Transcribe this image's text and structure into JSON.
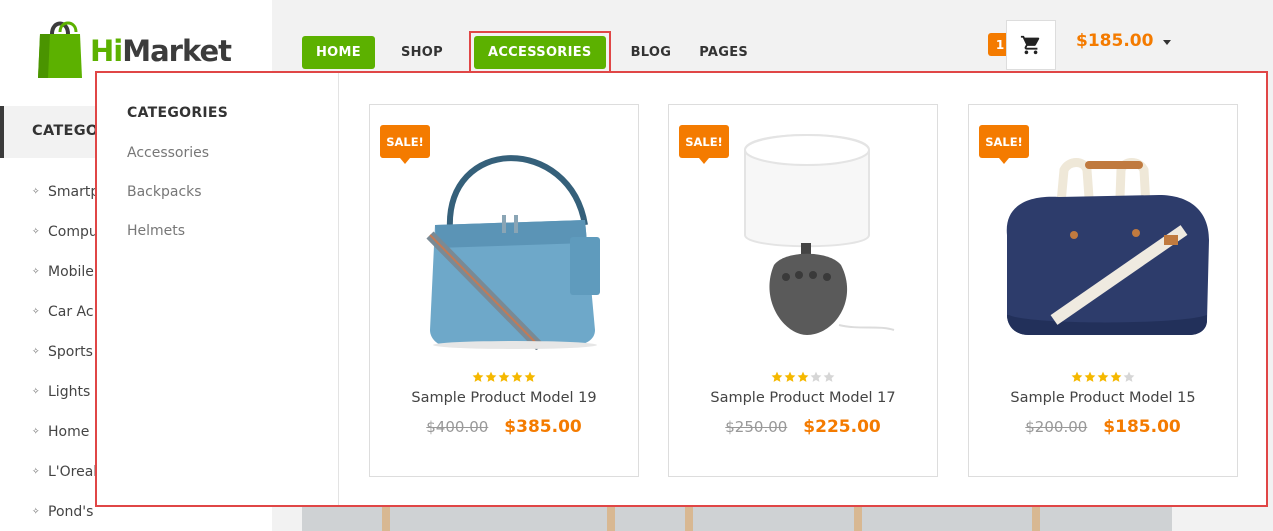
{
  "brand": {
    "name_hi": "Hi",
    "name_market": "Market",
    "colors": {
      "green": "#5cb100",
      "orange": "#f47b00"
    }
  },
  "sidebar": {
    "header": "CATEGO",
    "items": [
      "Smartp",
      "Compu",
      "Mobile",
      "Car Ac",
      "Sports",
      "Lights &",
      "Home ",
      "L'Oreal",
      "Pond's"
    ]
  },
  "nav": {
    "items": [
      "HOME",
      "SHOP",
      "ACCESSORIES",
      "BLOG",
      "PAGES"
    ],
    "active": "ACCESSORIES"
  },
  "cart": {
    "count": "1",
    "total": "$185.00",
    "icon": "cart-icon"
  },
  "mega_menu": {
    "title": "CATEGORIES",
    "links": [
      "Accessories",
      "Backpacks",
      "Helmets"
    ],
    "products": [
      {
        "badge": "SALE!",
        "name": "Sample Product Model 19",
        "old_price": "$400.00",
        "new_price": "$385.00",
        "rating": 5,
        "image": "blue-handbag"
      },
      {
        "badge": "SALE!",
        "name": "Sample Product Model 17",
        "old_price": "$250.00",
        "new_price": "$225.00",
        "rating": 3,
        "image": "table-lamp"
      },
      {
        "badge": "SALE!",
        "name": "Sample Product Model 15",
        "old_price": "$200.00",
        "new_price": "$185.00",
        "rating": 4,
        "image": "duffel-bag"
      }
    ]
  }
}
